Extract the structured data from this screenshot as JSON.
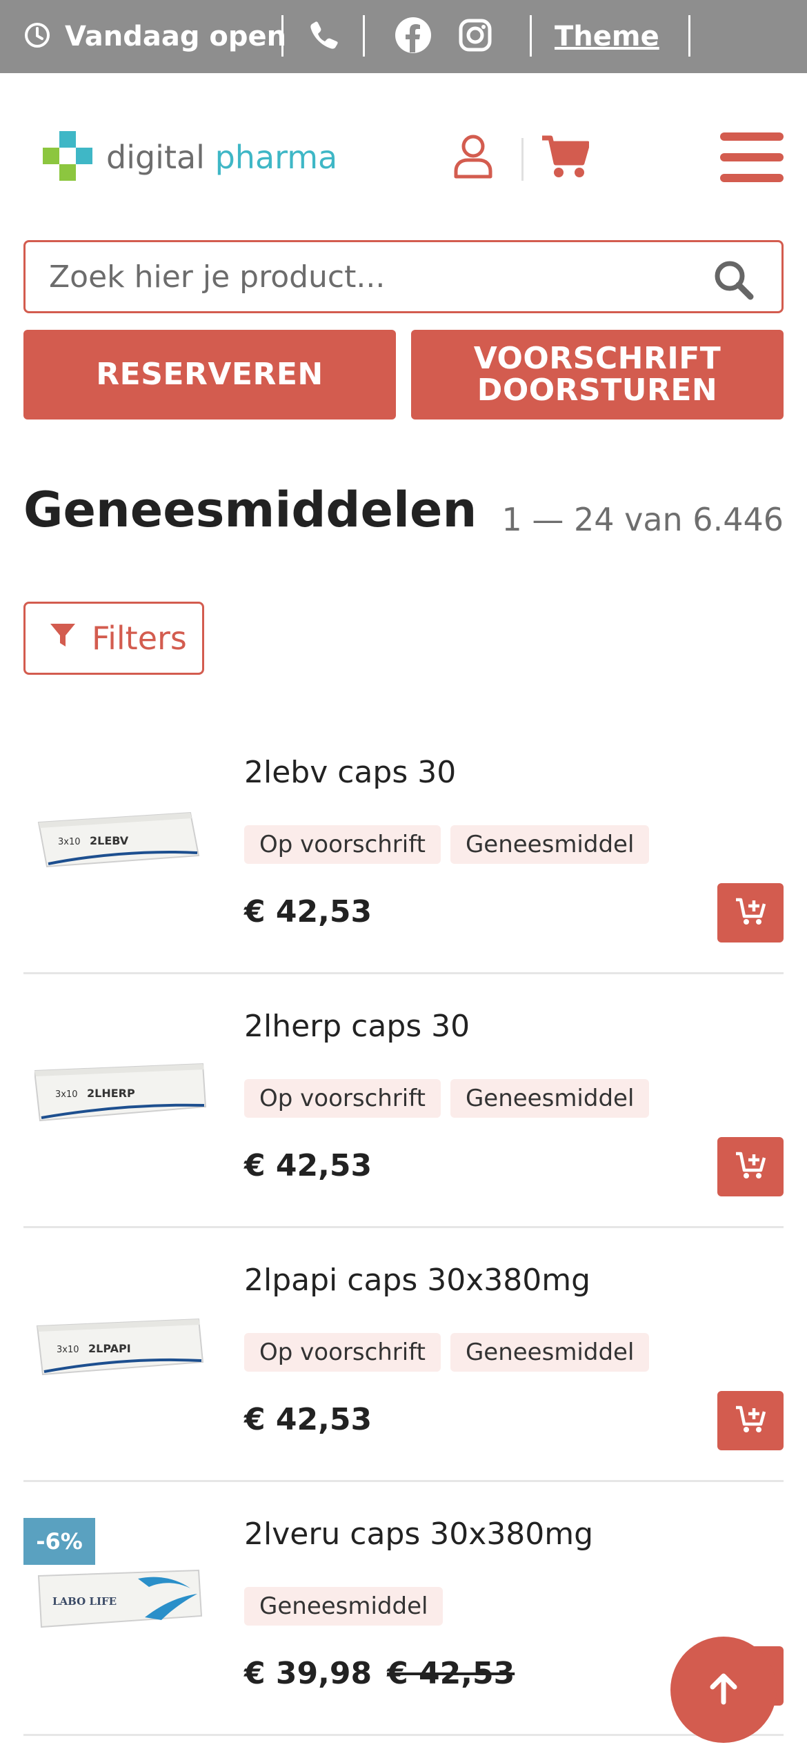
{
  "topbar": {
    "open_label": "Vandaag open",
    "theme_label": "Theme",
    "icons": [
      "clock-icon",
      "phone-icon",
      "facebook-icon",
      "instagram-icon"
    ],
    "bg_color": "#8e8e8e"
  },
  "header": {
    "logo_part1": "digital",
    "logo_part2": "pharma",
    "icons": [
      "user-icon",
      "cart-icon",
      "hamburger-menu-icon"
    ]
  },
  "search": {
    "placeholder": "Zoek hier je product..."
  },
  "actions": {
    "reserve_label": "RESERVEREN",
    "prescription_line1": "VOORSCHRIFT",
    "prescription_line2": "DOORSTUREN"
  },
  "listing": {
    "title": "Geneesmiddelen",
    "count": "1 — 24 van 6.446",
    "filters_label": "Filters"
  },
  "products": [
    {
      "name": "2lebv caps 30",
      "tags": [
        "Op voorschrift",
        "Geneesmiddel"
      ],
      "price": "€ 42,53",
      "image_label": "2LEBV"
    },
    {
      "name": "2lherp caps 30",
      "tags": [
        "Op voorschrift",
        "Geneesmiddel"
      ],
      "price": "€ 42,53",
      "image_label": "2LHERP"
    },
    {
      "name": "2lpapi caps 30x380mg",
      "tags": [
        "Op voorschrift",
        "Geneesmiddel"
      ],
      "price": "€ 42,53",
      "image_label": "2LPAPI"
    },
    {
      "name": "2lveru caps 30x380mg",
      "tags": [
        "Geneesmiddel"
      ],
      "price": "€ 39,98",
      "old_price": "€ 42,53",
      "badge": "-6%",
      "image_label": "LABO LIFE"
    }
  ],
  "floating": {
    "notice_label": "!"
  },
  "colors": {
    "accent": "#d35c4f",
    "tag_bg": "#fbecea",
    "badge_bg": "#5aa1c0",
    "logo_teal": "#3fb7c6"
  }
}
